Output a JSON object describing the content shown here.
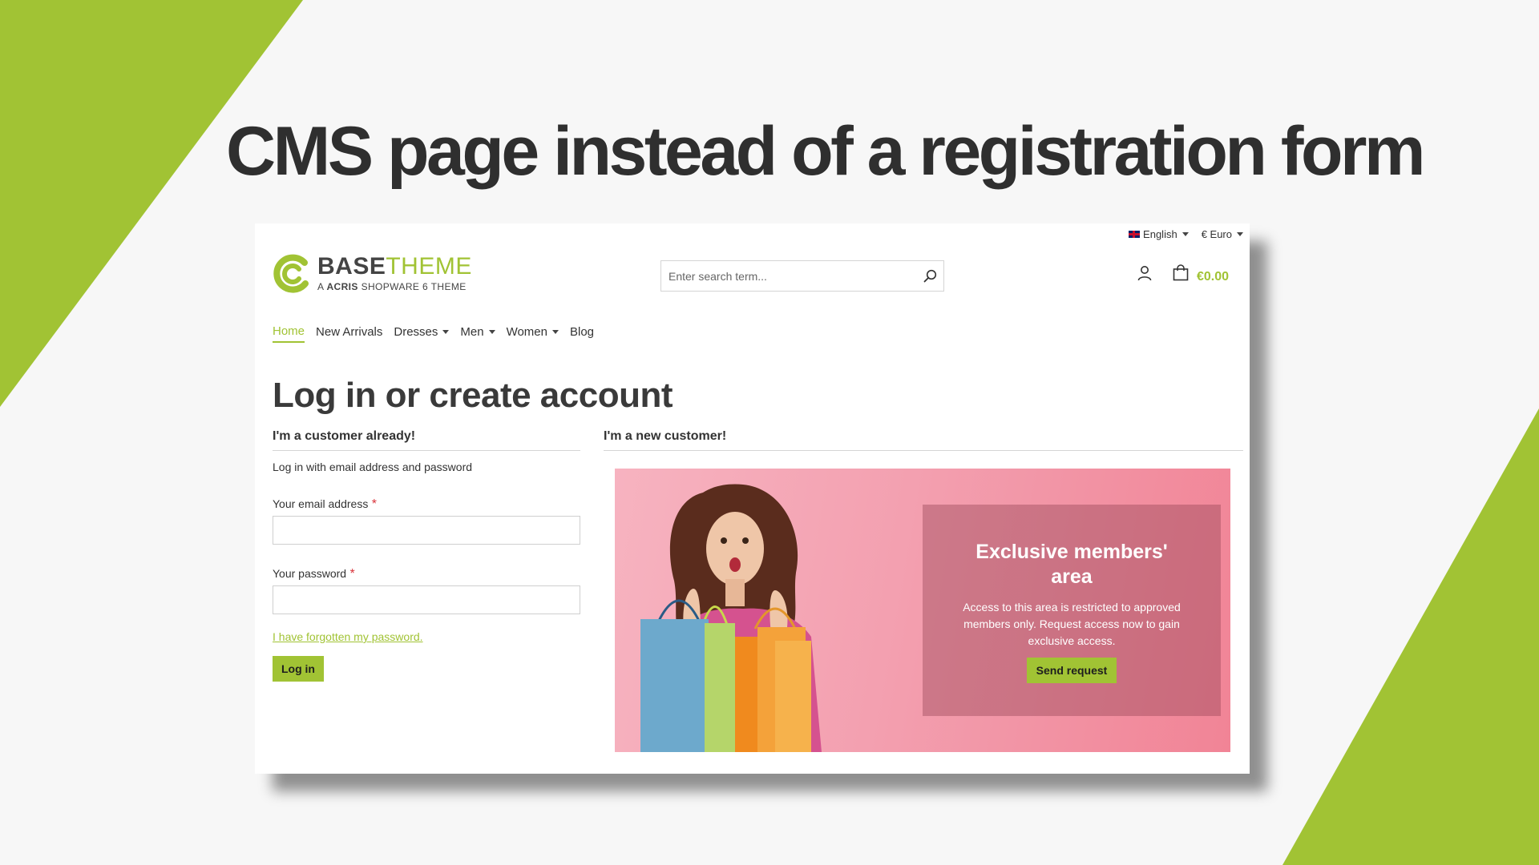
{
  "slide": {
    "title": "CMS page instead of a registration form",
    "accent_color": "#a1c334"
  },
  "topbar": {
    "language": "English",
    "currency": "€ Euro"
  },
  "logo": {
    "primary": "BASE",
    "secondary": "THEME",
    "tagline_prefix": "A",
    "tagline_brand": "ACRIS",
    "tagline_suffix": "SHOPWARE 6 THEME"
  },
  "search": {
    "placeholder": "Enter search term..."
  },
  "header": {
    "cart_total": "€0.00"
  },
  "nav": {
    "items": [
      {
        "label": "Home",
        "active": true,
        "dropdown": false
      },
      {
        "label": "New Arrivals",
        "active": false,
        "dropdown": false
      },
      {
        "label": "Dresses",
        "active": false,
        "dropdown": true
      },
      {
        "label": "Men",
        "active": false,
        "dropdown": true
      },
      {
        "label": "Women",
        "active": false,
        "dropdown": true
      },
      {
        "label": "Blog",
        "active": false,
        "dropdown": false
      }
    ]
  },
  "page": {
    "title": "Log in or create account"
  },
  "login": {
    "heading": "I'm a customer already!",
    "intro": "Log in with email address and password",
    "email_label": "Your email address",
    "password_label": "Your password",
    "required_mark": "*",
    "forgot_link": "I have forgotten my password.",
    "submit_label": "Log in"
  },
  "register": {
    "heading": "I'm a new customer!"
  },
  "promo": {
    "title": "Exclusive members' area",
    "text": "Access to this area is restricted to approved members only. Request access now to gain exclusive access.",
    "button_label": "Send request"
  }
}
